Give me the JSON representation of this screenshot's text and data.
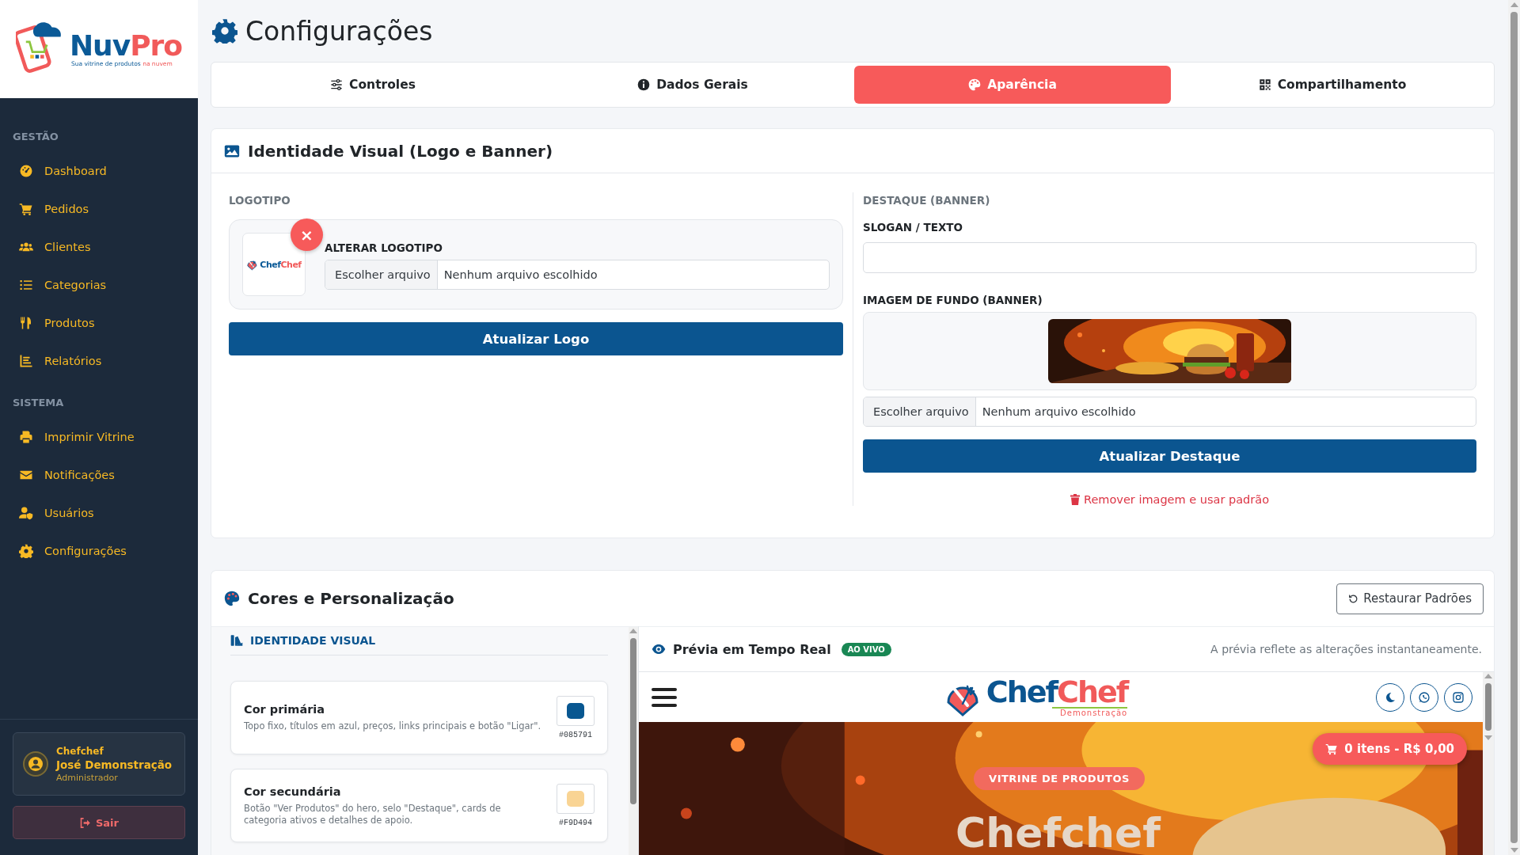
{
  "sidebar": {
    "brand": {
      "name": "Nuv",
      "name_accent": "Pro",
      "tagline": "Sua vitrine de produtos ",
      "tagline_accent": "na nuvem"
    },
    "sections": [
      {
        "title": "GESTÃO",
        "items": [
          {
            "label": "Dashboard"
          },
          {
            "label": "Pedidos"
          },
          {
            "label": "Clientes"
          },
          {
            "label": "Categorias"
          },
          {
            "label": "Produtos"
          },
          {
            "label": "Relatórios"
          }
        ]
      },
      {
        "title": "SISTEMA",
        "items": [
          {
            "label": "Imprimir Vitrine"
          },
          {
            "label": "Notificações"
          },
          {
            "label": "Usuários"
          },
          {
            "label": "Configurações"
          }
        ]
      }
    ],
    "user": {
      "company": "Chefchef",
      "name": "José Demonstração",
      "role": "Administrador"
    },
    "logout": "Sair"
  },
  "page": {
    "title": "Configurações"
  },
  "tabs": [
    {
      "label": "Controles",
      "selected": false
    },
    {
      "label": "Dados Gerais",
      "selected": false
    },
    {
      "label": "Aparência",
      "selected": true
    },
    {
      "label": "Compartilhamento",
      "selected": false
    }
  ],
  "identity_card": {
    "title": "Identidade Visual (Logo e Banner)",
    "logo": {
      "label": "LOGOTIPO",
      "preview": {
        "name": "Chef",
        "name_accent": "Chef"
      },
      "remove": "×",
      "field_label": "ALTERAR LOGOTIPO",
      "file": {
        "button": "Escolher arquivo",
        "value": "Nenhum arquivo escolhido"
      },
      "submit": "Atualizar Logo"
    },
    "banner": {
      "label": "DESTAQUE (BANNER)",
      "slogan_label": "SLOGAN / TEXTO",
      "image_label": "IMAGEM DE FUNDO (BANNER)",
      "file": {
        "button": "Escolher arquivo",
        "value": "Nenhum arquivo escolhido"
      },
      "submit": "Atualizar Destaque",
      "remove": "Remover imagem e usar padrão"
    }
  },
  "colors_card": {
    "title": "Cores e Personalização",
    "reset": "Restaurar Padrões",
    "section": "IDENTIDADE VISUAL",
    "colors": [
      {
        "name": "Cor primária",
        "description": "Topo fixo, títulos em azul, preços, links principais e botão \"Ligar\".",
        "value": "#085791",
        "color": "#085791"
      },
      {
        "name": "Cor secundária",
        "description": "Botão \"Ver Produtos\" do hero, selo \"Destaque\", cards de categoria ativos e detalhes de apoio.",
        "value": "#F9D494",
        "color": "#f9d494"
      }
    ]
  },
  "preview": {
    "title": "Prévia em Tempo Real",
    "badge": "AO VIVO",
    "note": "A prévia reflete as alterações instantaneamente.",
    "site": {
      "name": "Chef",
      "name_accent": "Chef",
      "subtitle": "Demonstração",
      "cart": "0 itens - R$ 0,00",
      "badge": "VITRINE DE PRODUTOS",
      "heading": "Chefchef"
    }
  }
}
